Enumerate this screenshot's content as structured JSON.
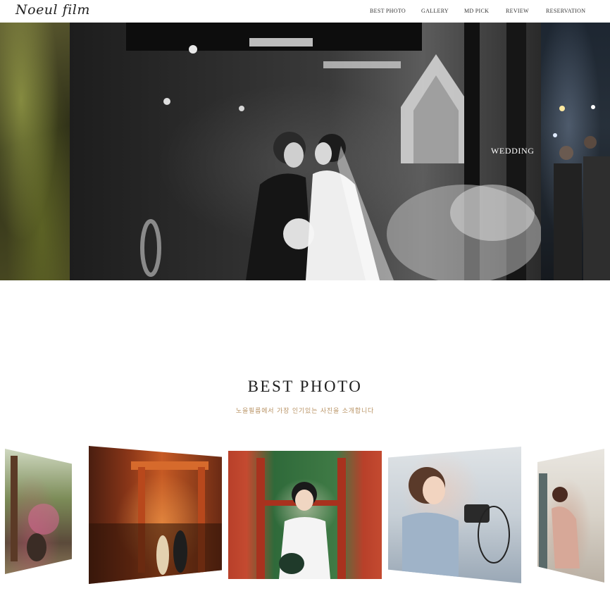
{
  "header": {
    "logo": "Noeul film",
    "nav": [
      {
        "label": "BEST PHOTO"
      },
      {
        "label": "GALLERY"
      },
      {
        "label": "MD PICK"
      },
      {
        "label": "REVIEW"
      },
      {
        "label": "RESERVATION"
      }
    ]
  },
  "hero": {
    "caption": "WEDDING"
  },
  "best_photo": {
    "title": "BEST PHOTO",
    "subtitle": "노을필름에서 가장 인기있는 사진을 소개합니다"
  }
}
